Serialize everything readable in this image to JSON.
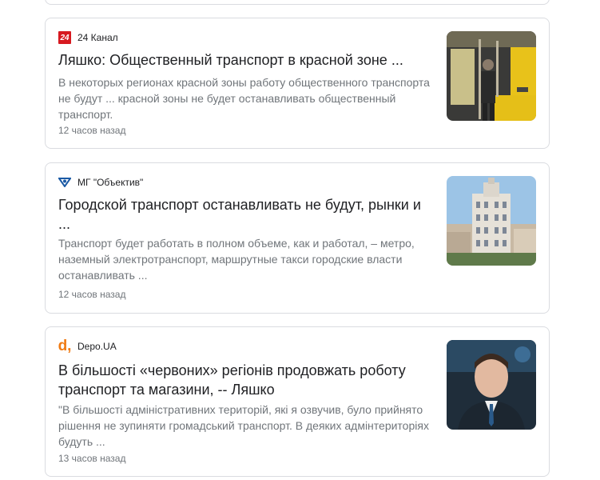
{
  "results": [
    {
      "source": "24 Канал",
      "logo_text": "24",
      "title": "Ляшко: Общественный транспорт в красной зоне ...",
      "snippet": "В некоторых регионах красной зоны работу общественного транспорта не будут ... красной зоны не будет останавливать общественный транспорт.",
      "time": "12 часов назад"
    },
    {
      "source": "МГ \"Объектив\"",
      "title": "Городской транспорт останавливать не будут, рынки и ...",
      "snippet": "Транспорт будет работать в полном объеме, как и работал, – метро, наземный электротранспорт, маршрутные такси городские власти останавливать ...",
      "time": "12 часов назад"
    },
    {
      "source": "Depo.UA",
      "logo_text": "d,",
      "title": "В більшості «червоних» регіонів продовжать роботу транспорт та магазини, -- Ляшко",
      "snippet": "\"В більшості адміністративних територій, які я озвучив, було прийнято рішення не зупиняти громадський транспорт. В деяких адмінтериторіях будуть ...",
      "time": "13 часов назад"
    }
  ]
}
